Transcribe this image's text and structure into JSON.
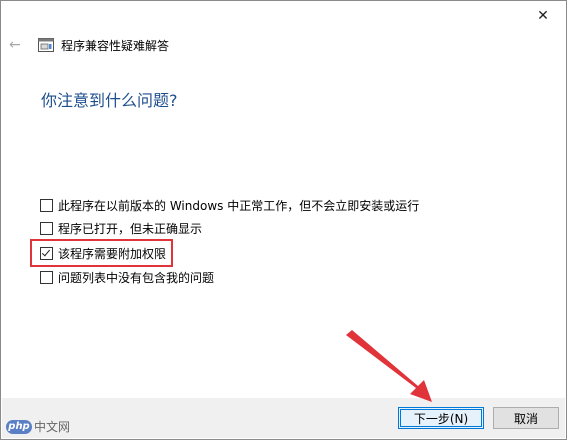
{
  "window": {
    "close_glyph": "✕",
    "back_glyph": "←",
    "title": "程序兼容性疑难解答"
  },
  "main": {
    "heading": "你注意到什么问题?",
    "options": [
      {
        "label": "此程序在以前版本的 Windows 中正常工作，但不会立即安装或运行",
        "checked": false
      },
      {
        "label": "程序已打开，但未正确显示",
        "checked": false
      },
      {
        "label": "该程序需要附加权限",
        "checked": true
      },
      {
        "label": "问题列表中没有包含我的问题",
        "checked": false
      }
    ]
  },
  "footer": {
    "next_label": "下一步(N)",
    "cancel_label": "取消"
  },
  "watermark": {
    "logo_text": "php",
    "site_text": "中文网"
  },
  "colors": {
    "heading": "#1e4e8c",
    "highlight": "#e0333a",
    "arrow": "#e0333a",
    "primary_button_border": "#0078d7"
  },
  "icons": {
    "app": "troubleshooter-icon",
    "back": "back-arrow-icon",
    "close": "close-icon"
  }
}
